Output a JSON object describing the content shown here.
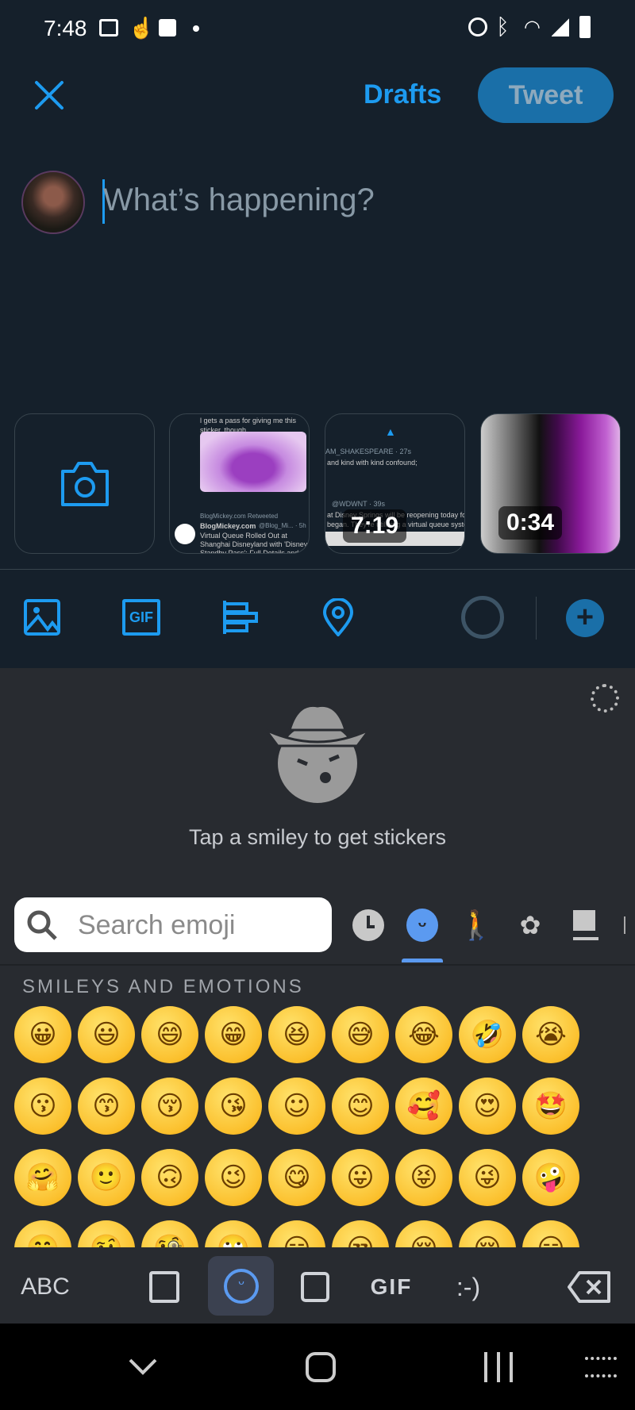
{
  "status_bar": {
    "time": "7:48",
    "left_icons": [
      "image-icon",
      "touch-icon",
      "message-icon",
      "dot-icon"
    ],
    "right_icons": [
      "alarm-icon",
      "bluetooth-icon",
      "wifi-icon",
      "signal-icon",
      "battery-icon"
    ]
  },
  "header": {
    "drafts_label": "Drafts",
    "tweet_label": "Tweet",
    "accent": "#1d9bf0"
  },
  "compose": {
    "placeholder": "What’s happening?"
  },
  "media_strip": [
    {
      "type": "camera"
    },
    {
      "type": "screenshot",
      "text_top": "l gets a pass for giving me this sticker, though.",
      "retweet": "BlogMickey.com Retweeted",
      "author": "BlogMickey.com",
      "handle": "@Blog_Mi... · 5h",
      "body": "Virtual Queue Rolled Out at Shanghai Disneyland with 'Disney Standby Pass'; Full Details and Step-by-Step"
    },
    {
      "type": "video",
      "duration": "7:19",
      "line1": "AM_SHAKESPEARE · 27s",
      "line2": "and kind with kind confound;",
      "line3": "@WDWNT · 39s",
      "line4": "at Disney Springs will be reopening today for the",
      "line5": "began. They're utilizing a virtual queue system li"
    },
    {
      "type": "video",
      "duration": "0:34"
    }
  ],
  "toolbar": {
    "icons": [
      "image-icon",
      "gif-icon",
      "poll-icon",
      "location-icon"
    ],
    "gif_label": "GIF"
  },
  "keyboard": {
    "sticker_prompt": "Tap a smiley to get stickers",
    "search_placeholder": "Search emoji",
    "categories": [
      "recent-icon",
      "smileys-icon",
      "people-icon",
      "animals-icon",
      "food-icon"
    ],
    "section_title": "SMILEYS AND EMOTIONS",
    "emoji_rows": [
      [
        "😀",
        "😃",
        "😄",
        "😁",
        "😆",
        "😅",
        "😂",
        "🤣",
        "😭"
      ],
      [
        "😗",
        "😙",
        "😚",
        "😘",
        "☺",
        "😊",
        "🥰",
        "😍",
        "🤩"
      ],
      [
        "🤗",
        "🙂",
        "🙃",
        "😉",
        "😋",
        "😛",
        "😝",
        "😜",
        "🤪"
      ],
      [
        "🤭",
        "🤨",
        "🧐",
        "🙄",
        "😏",
        "😒",
        "😔",
        "😌",
        "😑"
      ]
    ],
    "bottom": {
      "abc": "ABC",
      "gif": "GIF",
      "emoticon": ":-)"
    }
  }
}
